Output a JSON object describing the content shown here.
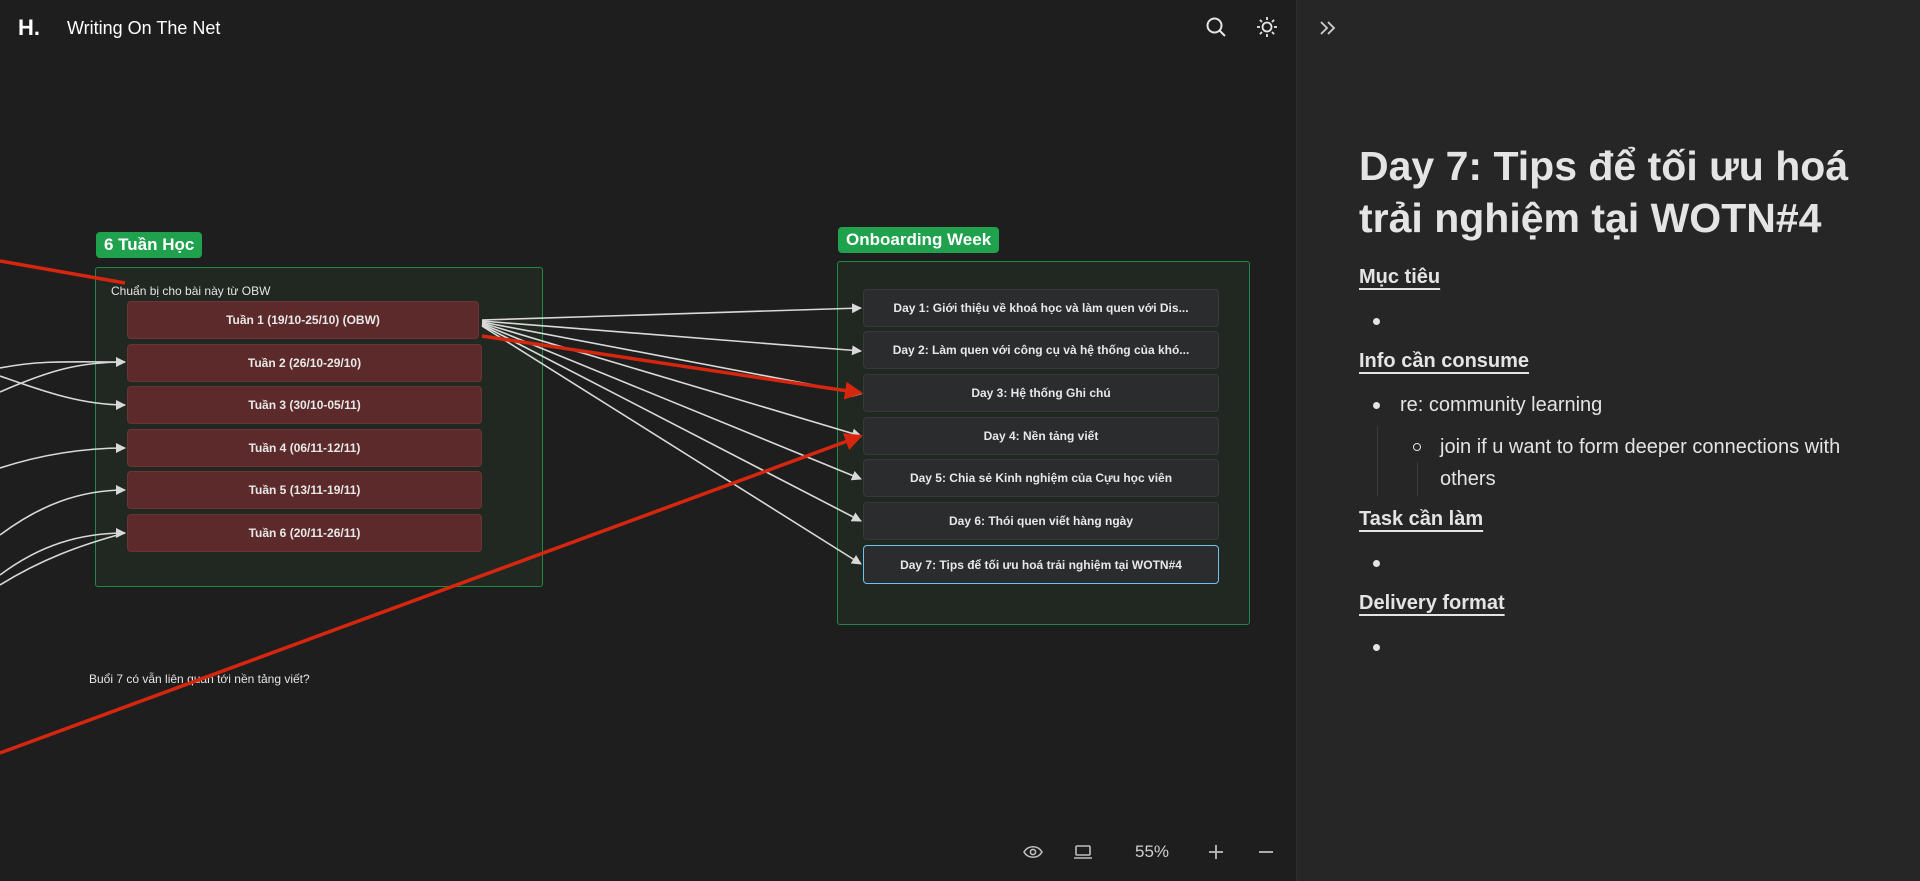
{
  "header": {
    "logo_text": "H.",
    "site_title": "Writing On The Net",
    "search_icon": "search-icon",
    "theme_icon": "sun-icon"
  },
  "canvas": {
    "group_left": {
      "title": "6 Tuần Học",
      "note": "Chuẩn bị cho bài này từ OBW",
      "weeks": [
        "Tuần 1 (19/10-25/10) (OBW)",
        "Tuần 2 (26/10-29/10)",
        "Tuần 3 (30/10-05/11)",
        "Tuần 4 (06/11-12/11)",
        "Tuần 5 (13/11-19/11)",
        "Tuần 6 (20/11-26/11)"
      ]
    },
    "group_right": {
      "title": "Onboarding Week",
      "days": [
        "Day 1: Giới thiệu về khoá học và làm quen với Dis...",
        "Day 2: Làm quen với công cụ và hệ thống của khó...",
        "Day 3: Hệ thống Ghi chú",
        "Day 4: Nền tảng viết",
        "Day 5: Chia sẻ Kinh nghiệm của Cựu học viên",
        "Day 6: Thói quen viết hàng ngày",
        "Day 7: Tips để tối ưu hoá trải nghiệm tại WOTN#4"
      ]
    },
    "bottom_note": "Buổi 7 có vẫn liên quan tới nền tảng viết?",
    "colors": {
      "group_border": "#1f8a45",
      "group_title_bg": "#1fa14d",
      "week_node": "#5c2a2a",
      "day_node": "#2b2c2e",
      "arrow_red": "#d7260f",
      "arrow_white": "#d9d9d9",
      "selected_border": "#6ec3f0"
    }
  },
  "controls": {
    "zoom": "55%",
    "view_icon": "eye-icon",
    "fit_icon": "laptop-icon",
    "zoom_in_icon": "plus-icon",
    "zoom_out_icon": "minus-icon"
  },
  "panel": {
    "collapse_icon": "chevrons-right-icon",
    "title": "Day 7: Tips để tối ưu hoá trải nghiệm tại WOTN#4",
    "sections": [
      {
        "heading": "Mục tiêu"
      },
      {
        "heading": "Info cần consume",
        "item": "re: community learning",
        "sub_item": "join if u want to form deeper connections with others"
      },
      {
        "heading": "Task cần làm"
      },
      {
        "heading": "Delivery format"
      }
    ]
  }
}
